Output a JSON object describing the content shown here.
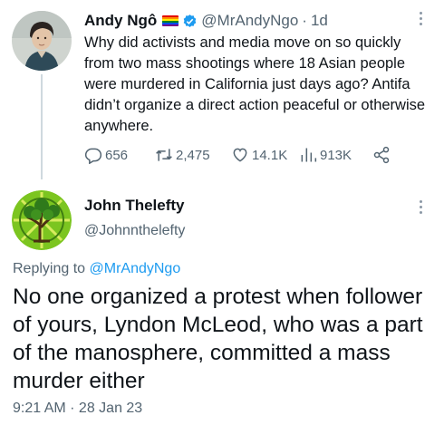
{
  "tweet": {
    "author_name": "Andy Ngô",
    "author_handle": "@MrAndyNgo",
    "separator": "·",
    "time_ago": "1d",
    "text": "Why did activists and media move on so quickly from two mass shootings where 18 Asian people were murdered in California just days ago? Antifa didn’t organize a direct action peaceful or otherwise anywhere.",
    "icons": [
      "rainbow-flag-icon",
      "verified-badge-icon",
      "more-icon"
    ],
    "stats": {
      "replies": "656",
      "retweets": "2,475",
      "likes": "14.1K",
      "views": "913K"
    },
    "action_icons": [
      "reply-icon",
      "retweet-icon",
      "like-icon",
      "views-icon",
      "share-icon"
    ]
  },
  "reply": {
    "author_name": "John Thelefty",
    "author_handle": "@Johnnthelefty",
    "replying_prefix": "Replying to",
    "replying_to": "@MrAndyNgo",
    "text": "No one organized a protest when follower of yours,  Lyndon McLeod, who was a part of the manosphere, committed a mass murder either",
    "timestamp": "9:21 AM · 28 Jan 23"
  },
  "colors": {
    "link": "#1d9bf0",
    "secondary_text": "#536471",
    "primary_text": "#0f1419",
    "avatar_green": "#7cc520"
  }
}
